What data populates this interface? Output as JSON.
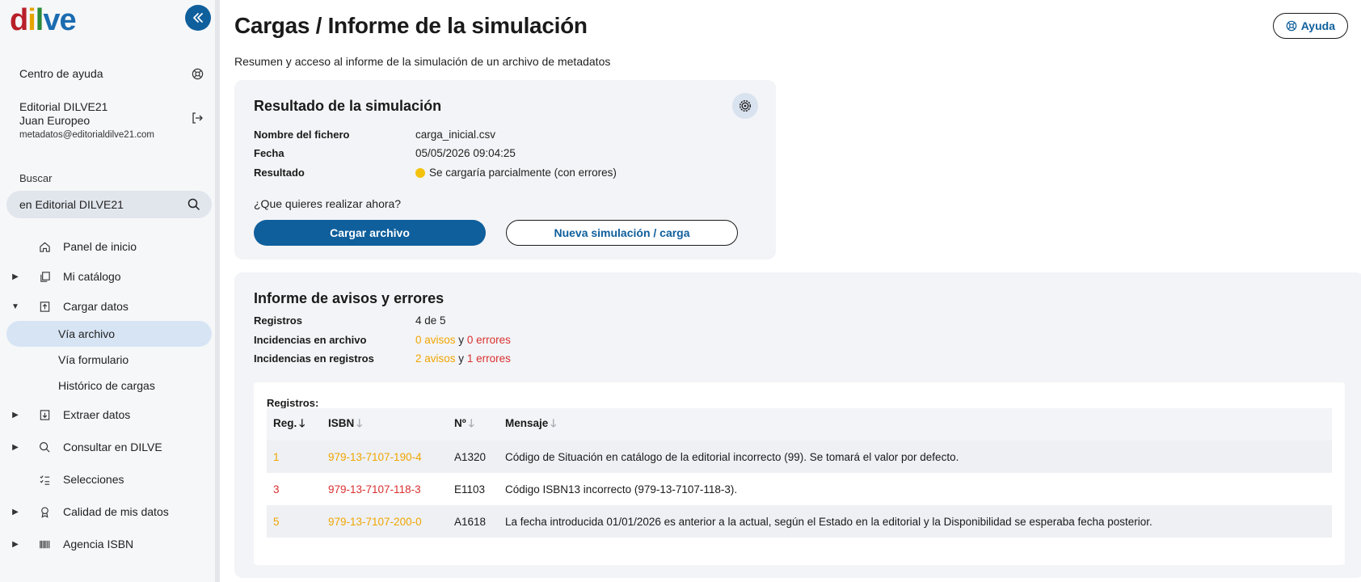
{
  "sidebar": {
    "logo": [
      "d",
      "i",
      "l",
      "v",
      "e"
    ],
    "help_center": "Centro de ayuda",
    "user": {
      "company": "Editorial DILVE21",
      "name": "Juan Europeo",
      "email": "metadatos@editorialdilve21.com"
    },
    "search": {
      "label": "Buscar",
      "value": "en Editorial DILVE21"
    },
    "nav": [
      {
        "label": "Panel de inicio",
        "icon": "home-icon"
      },
      {
        "label": "Mi catálogo",
        "icon": "copy-icon"
      },
      {
        "label": "Cargar datos",
        "icon": "upload-icon"
      },
      {
        "label": "Vía archivo"
      },
      {
        "label": "Vía formulario"
      },
      {
        "label": "Histórico de cargas"
      },
      {
        "label": "Extraer datos",
        "icon": "download-icon"
      },
      {
        "label": "Consultar en DILVE",
        "icon": "search-icon"
      },
      {
        "label": "Selecciones",
        "icon": "checklist-icon"
      },
      {
        "label": "Calidad de mis datos",
        "icon": "award-icon"
      },
      {
        "label": "Agencia ISBN",
        "icon": "barcode-icon"
      }
    ]
  },
  "header": {
    "title": "Cargas / Informe de la simulación",
    "subtitle": "Resumen y acceso al informe de la simulación de un archivo de metadatos",
    "help_label": "Ayuda"
  },
  "result": {
    "title": "Resultado de la simulación",
    "rows": [
      {
        "key": "Nombre del fichero",
        "value": "carga_inicial.csv"
      },
      {
        "key": "Fecha",
        "value": "05/05/2026 09:04:25"
      },
      {
        "key": "Resultado",
        "value": "Se cargaría parcialmente (con errores)"
      }
    ],
    "question": "¿Que quieres realizar ahora?",
    "primary_button": "Cargar archivo",
    "secondary_button": "Nueva simulación / carga",
    "status_color": "#f4c20d"
  },
  "report": {
    "title": "Informe de avisos y errores",
    "registros_label": "Registros",
    "registros_value": "4 de 5",
    "archivo_label": "Incidencias en archivo",
    "archivo_avisos": "0 avisos",
    "archivo_errores": "0 errores",
    "registros_inc_label": "Incidencias en registros",
    "registros_avisos": "2 avisos",
    "registros_errores": "1 errores",
    "conjunction": "y",
    "table_caption": "Registros:",
    "columns": [
      "Reg.",
      "ISBN",
      "Nº",
      "Mensaje"
    ],
    "rows": [
      {
        "reg": "1",
        "isbn": "979-13-7107-190-4",
        "code": "A1320",
        "msg": "Código de Situación en catálogo de la editorial incorrecto (99). Se tomará el valor por defecto.",
        "level": "warn"
      },
      {
        "reg": "3",
        "isbn": "979-13-7107-118-3",
        "code": "E1103",
        "msg": "Código ISBN13 incorrecto (979-13-7107-118-3).",
        "level": "err"
      },
      {
        "reg": "5",
        "isbn": "979-13-7107-200-0",
        "code": "A1618",
        "msg": "La fecha introducida 01/01/2026 es anterior a la actual, según el Estado en la editorial y la Disponibilidad se esperaba fecha posterior.",
        "level": "warn"
      }
    ]
  },
  "colors": {
    "primary": "#0f5f9c",
    "warning": "#f0a500",
    "error": "#d9302f",
    "active_nav": "#d6e4f4"
  }
}
